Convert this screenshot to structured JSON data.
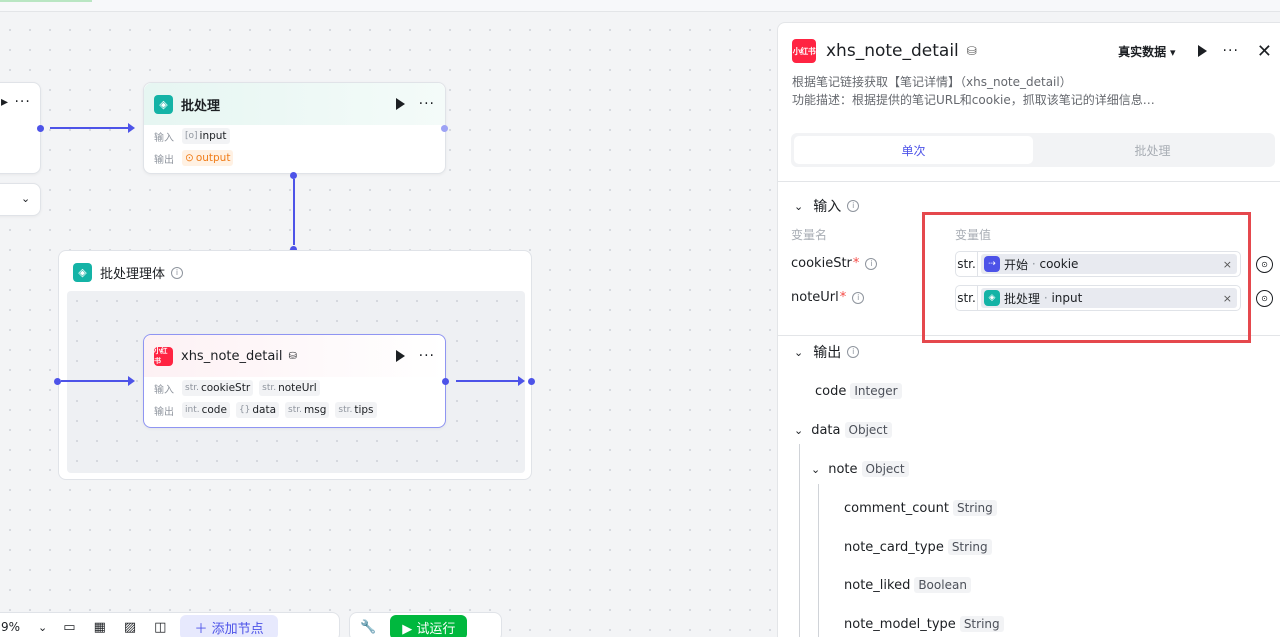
{
  "canvas": {
    "node_batch": {
      "title": "批处理",
      "in_label": "输入",
      "out_label": "输出",
      "in_type": "[o]",
      "in_name": "input",
      "out_icon": "⊙",
      "out_name": "output"
    },
    "group": {
      "title": "批处理理体"
    },
    "node_xhs": {
      "icon_text": "小红书",
      "title": "xhs_note_detail",
      "in_label": "输入",
      "out_label": "输出",
      "inputs": [
        {
          "type": "str.",
          "name": "cookieStr"
        },
        {
          "type": "str.",
          "name": "noteUrl"
        }
      ],
      "outputs": [
        {
          "type": "int.",
          "name": "code"
        },
        {
          "type": "{}",
          "name": "data"
        },
        {
          "type": "str.",
          "name": "msg"
        },
        {
          "type": "str.",
          "name": "tips"
        }
      ]
    },
    "bottom": {
      "zoom": "9%",
      "add_node": "添加节点",
      "run": "试运行"
    }
  },
  "panel": {
    "icon_text": "小红书",
    "title": "xhs_note_detail",
    "data_source": "真实数据",
    "desc1": "根据笔记链接获取【笔记详情】（xhs_note_detail）",
    "desc2": "功能描述：根据提供的笔记URL和cookie，抓取该笔记的详细信息…",
    "tabs": [
      "单次",
      "批处理"
    ],
    "input_section": "输入",
    "col_name": "变量名",
    "col_value": "变量值",
    "vars": [
      {
        "name": "cookieStr",
        "req": "*",
        "type": "str.",
        "ref_node": "开始",
        "ref_sep": " · ",
        "ref_var": "cookie"
      },
      {
        "name": "noteUrl",
        "req": "*",
        "type": "str.",
        "ref_node": "批处理",
        "ref_sep": " · ",
        "ref_var": "input"
      }
    ],
    "output_section": "输出",
    "outputs": [
      {
        "name": "code",
        "type": "Integer"
      },
      {
        "name": "data",
        "type": "Object"
      },
      {
        "name": "note",
        "type": "Object"
      },
      {
        "name": "comment_count",
        "type": "String"
      },
      {
        "name": "note_card_type",
        "type": "String"
      },
      {
        "name": "note_liked",
        "type": "Boolean"
      },
      {
        "name": "note_model_type",
        "type": "String"
      }
    ]
  }
}
